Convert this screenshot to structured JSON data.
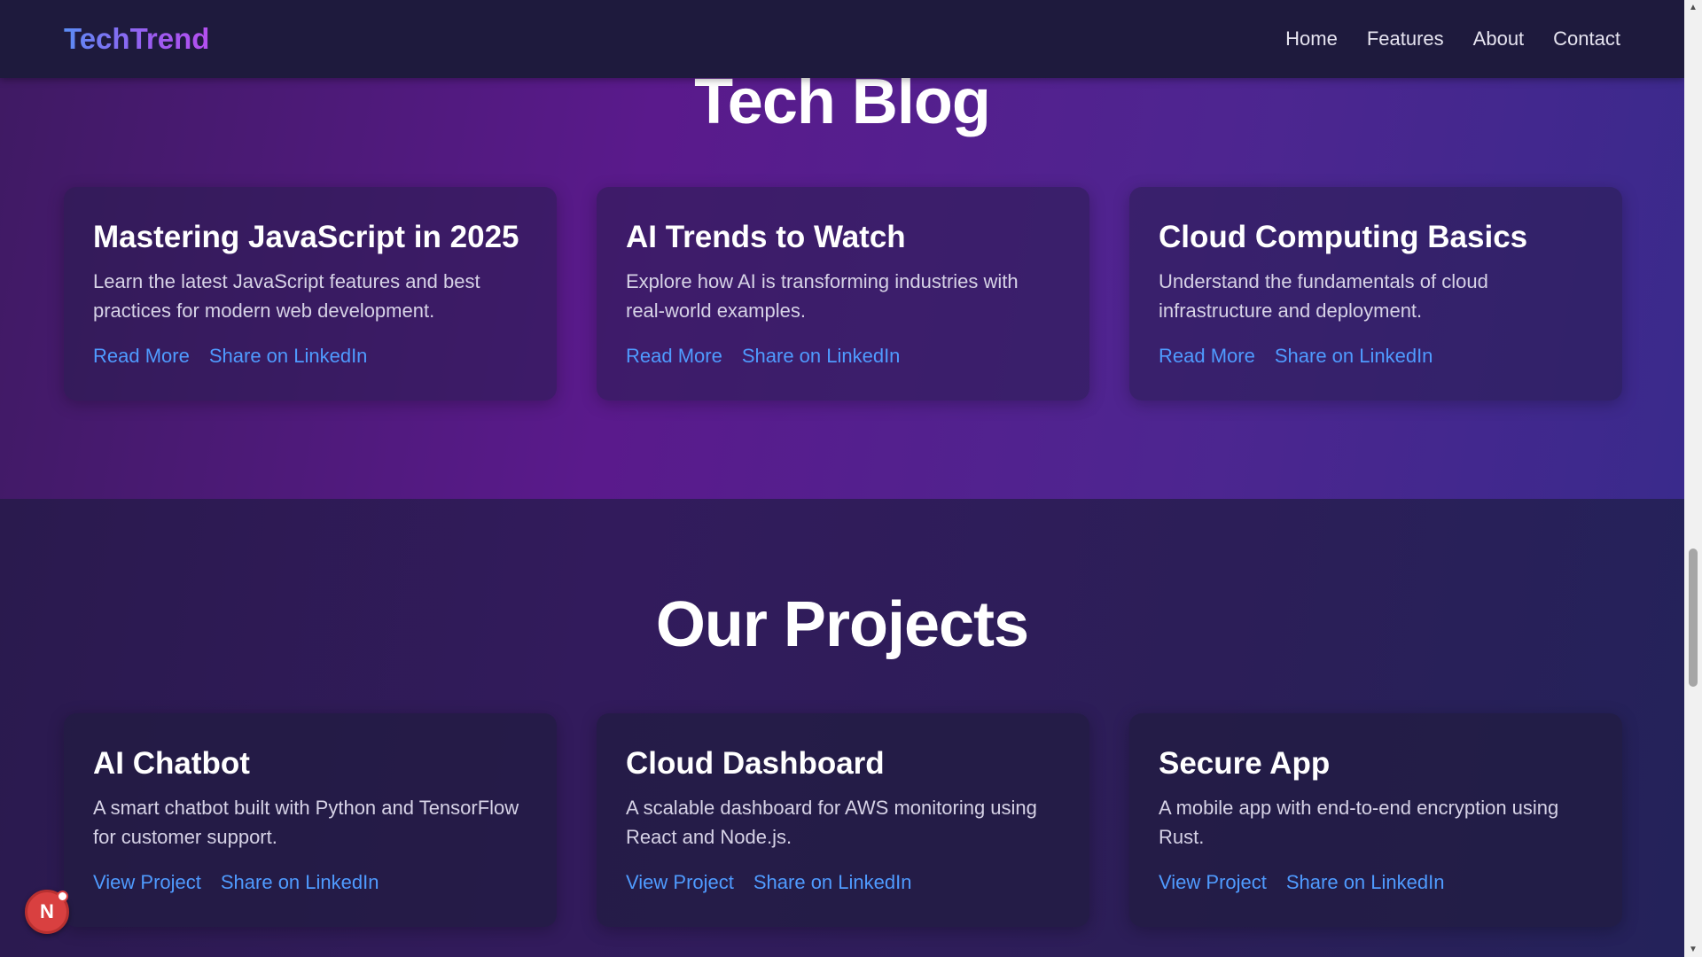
{
  "header": {
    "logo": "TechTrend",
    "nav": [
      "Home",
      "Features",
      "About",
      "Contact"
    ]
  },
  "blog": {
    "title": "Tech Blog",
    "cards": [
      {
        "title": "Mastering JavaScript in 2025",
        "desc": "Learn the latest JavaScript features and best practices for modern web development.",
        "link1": "Read More",
        "link2": "Share on LinkedIn"
      },
      {
        "title": "AI Trends to Watch",
        "desc": "Explore how AI is transforming industries with real-world examples.",
        "link1": "Read More",
        "link2": "Share on LinkedIn"
      },
      {
        "title": "Cloud Computing Basics",
        "desc": "Understand the fundamentals of cloud infrastructure and deployment.",
        "link1": "Read More",
        "link2": "Share on LinkedIn"
      }
    ]
  },
  "projects": {
    "title": "Our Projects",
    "cards": [
      {
        "title": "AI Chatbot",
        "desc": "A smart chatbot built with Python and TensorFlow for customer support.",
        "link1": "View Project",
        "link2": "Share on LinkedIn"
      },
      {
        "title": "Cloud Dashboard",
        "desc": "A scalable dashboard for AWS monitoring using React and Node.js.",
        "link1": "View Project",
        "link2": "Share on LinkedIn"
      },
      {
        "title": "Secure App",
        "desc": "A mobile app with end-to-end encryption using Rust.",
        "link1": "View Project",
        "link2": "Share on LinkedIn"
      }
    ]
  },
  "fab": {
    "initial": "N"
  },
  "colors": {
    "link": "#4f9bff",
    "navbar": "#1e1a3d",
    "logo_gradient_start": "#5b8cf5",
    "logo_gradient_end": "#b44ff0"
  }
}
